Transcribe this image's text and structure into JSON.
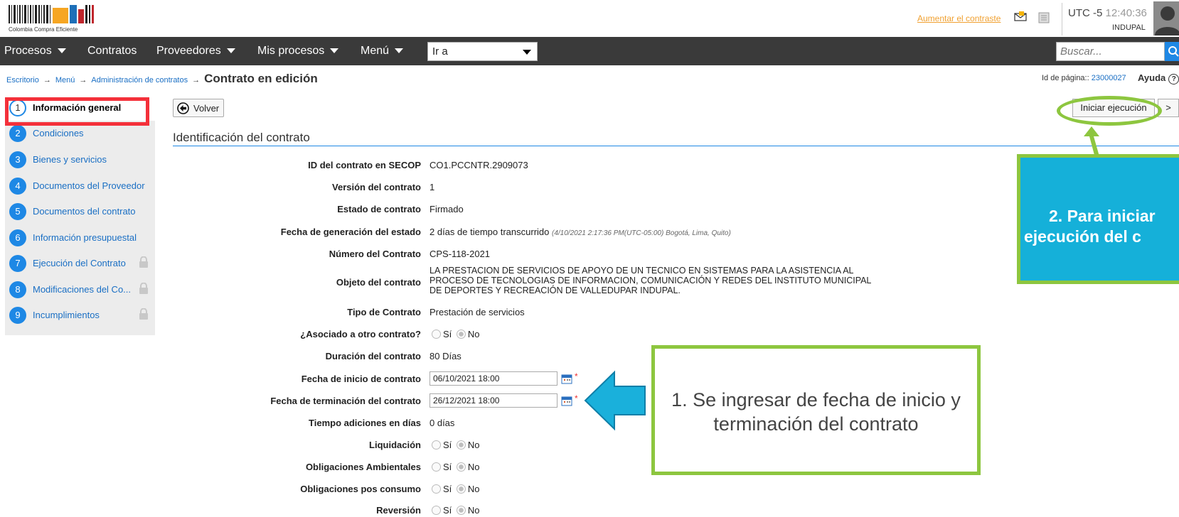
{
  "header": {
    "logo_text": "Colombia Compra Eficiente",
    "contrast_link": "Aumentar el contraste",
    "mail_badge": "1",
    "utc_label": "UTC -5",
    "utc_time": "12:40:36",
    "org": "INDUPAL"
  },
  "nav": {
    "items": [
      "Procesos",
      "Contratos",
      "Proveedores",
      "Mis procesos",
      "Menú"
    ],
    "goto_value": "Ir a",
    "search_placeholder": "Buscar..."
  },
  "breadcrumb": {
    "items": [
      "Escritorio",
      "Menú",
      "Administración de contratos"
    ],
    "current": "Contrato en edición",
    "page_id_label": "Id de página::",
    "page_id_value": "23000027",
    "help": "Ayuda"
  },
  "sidebar": {
    "items": [
      {
        "num": "1",
        "label": "Información general",
        "locked": false,
        "active": true
      },
      {
        "num": "2",
        "label": "Condiciones",
        "locked": false
      },
      {
        "num": "3",
        "label": "Bienes y servicios",
        "locked": false
      },
      {
        "num": "4",
        "label": "Documentos del Proveedor",
        "locked": false
      },
      {
        "num": "5",
        "label": "Documentos del contrato",
        "locked": false
      },
      {
        "num": "6",
        "label": "Información presupuestal",
        "locked": false
      },
      {
        "num": "7",
        "label": "Ejecución del Contrato",
        "locked": true
      },
      {
        "num": "8",
        "label": "Modificaciones del Co...",
        "locked": true
      },
      {
        "num": "9",
        "label": "Incumplimientos",
        "locked": true
      }
    ]
  },
  "toolbar": {
    "back_label": "Volver",
    "start_label": "Iniciar ejecución",
    "next_label": ">"
  },
  "section": {
    "title": "Identificación del contrato",
    "fields": {
      "secop_id": {
        "label": "ID del contrato en SECOP",
        "value": "CO1.PCCNTR.2909073"
      },
      "version": {
        "label": "Versión del contrato",
        "value": "1"
      },
      "state": {
        "label": "Estado de contrato",
        "value": "Firmado"
      },
      "state_date": {
        "label": "Fecha de generación del estado",
        "value": "2 días de tiempo transcurrido",
        "note": "(4/10/2021 2:17:36 PM(UTC-05:00) Bogotá, Lima, Quito)"
      },
      "number": {
        "label": "Número del Contrato",
        "value": "CPS-118-2021"
      },
      "object": {
        "label": "Objeto del contrato",
        "value": "LA PRESTACION DE SERVICIOS DE APOYO DE UN TECNICO EN SISTEMAS PARA LA ASISTENCIA AL PROCESO DE TECNOLOGIAS DE INFORMACION, COMUNICACIÓN Y REDES DEL INSTITUTO MUNICIPAL DE DEPORTES Y RECREACIÓN DE VALLEDUPAR INDUPAL."
      },
      "type": {
        "label": "Tipo de Contrato",
        "value": "Prestación de servicios"
      },
      "associated": {
        "label": "¿Asociado a otro contrato?"
      },
      "duration": {
        "label": "Duración del contrato",
        "value": "80 Días"
      },
      "start_date": {
        "label": "Fecha de inicio de contrato",
        "value": "06/10/2021 18:00"
      },
      "end_date": {
        "label": "Fecha de terminación del contrato",
        "value": "26/12/2021 18:00"
      },
      "additions": {
        "label": "Tiempo adiciones en días",
        "value": "0 días"
      },
      "liquidation": {
        "label": "Liquidación"
      },
      "environmental": {
        "label": "Obligaciones Ambientales"
      },
      "post_consumption": {
        "label": "Obligaciones pos consumo"
      },
      "reversion": {
        "label": "Reversión"
      }
    },
    "radio_yes": "Sí",
    "radio_no": "No",
    "required_mark": "*"
  },
  "callouts": {
    "dates": "1. Se ingresar de fecha de inicio y terminación del contrato",
    "start_line1": "2. Para iniciar",
    "start_line2": "ejecución del c"
  },
  "colors": {
    "nav_bg": "#3a3a3a",
    "accent_blue": "#1e88e5",
    "highlight_red": "#f4303a",
    "highlight_green": "#8dc63f",
    "callout_blue": "#15b0d9"
  }
}
